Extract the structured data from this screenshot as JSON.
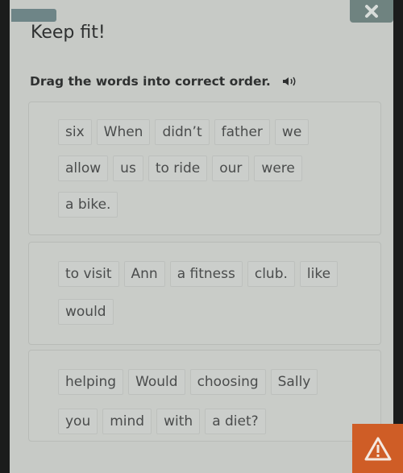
{
  "header": {
    "title": "Keep fit!",
    "instruction": "Drag the words into correct order."
  },
  "icons": {
    "close": "close-icon",
    "speaker": "speaker-icon",
    "warning": "warning-icon"
  },
  "colors": {
    "accent_warning": "#cf5d26",
    "close_button": "#6f8380"
  },
  "exercises": [
    {
      "rows": [
        [
          "six",
          "When",
          "didn’t",
          "father",
          "we"
        ],
        [
          "allow",
          "us",
          "to ride",
          "our",
          "were"
        ],
        [
          "a bike."
        ]
      ]
    },
    {
      "rows": [
        [
          "to visit",
          "Ann",
          "a fitness",
          "club.",
          "like"
        ],
        [
          "would"
        ]
      ]
    },
    {
      "rows": [
        [
          "helping",
          "Would",
          "choosing",
          "Sally"
        ],
        [
          "you",
          "mind",
          "with",
          "a diet?"
        ]
      ]
    }
  ]
}
